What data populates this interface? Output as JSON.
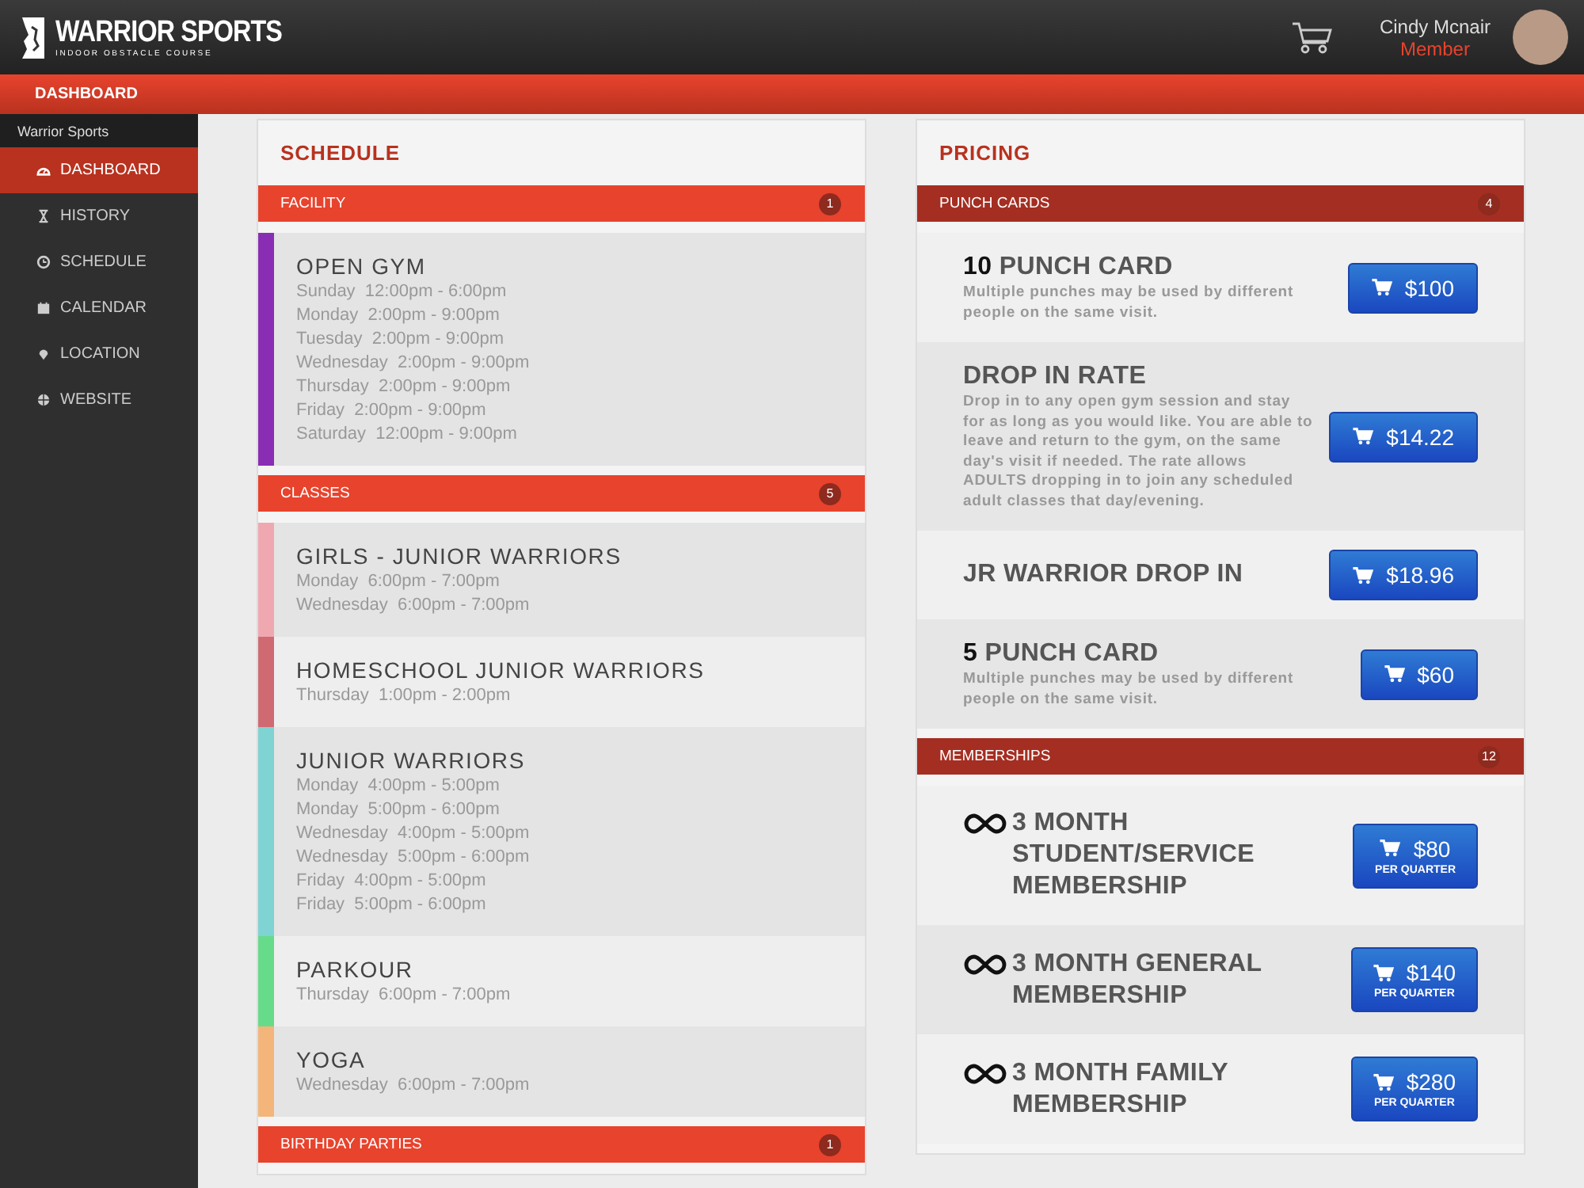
{
  "header": {
    "logo_title": "WARRIOR SPORTS",
    "logo_subtitle": "INDOOR OBSTACLE COURSE",
    "user": {
      "name": "Cindy Mcnair",
      "role": "Member"
    }
  },
  "breadcrumb": "DASHBOARD",
  "sidebar": {
    "title": "Warrior Sports",
    "items": [
      {
        "label": "DASHBOARD",
        "selected": true
      },
      {
        "label": "HISTORY",
        "selected": false
      },
      {
        "label": "SCHEDULE",
        "selected": false
      },
      {
        "label": "CALENDAR",
        "selected": false
      },
      {
        "label": "LOCATION",
        "selected": false
      },
      {
        "label": "WEBSITE",
        "selected": false
      }
    ]
  },
  "schedule": {
    "title": "SCHEDULE",
    "sections": [
      {
        "title": "FACILITY",
        "count": "1",
        "items": [
          {
            "name": "OPEN GYM",
            "color": "#8a2db5",
            "times": [
              "Sunday  12:00pm - 6:00pm",
              "Monday  2:00pm - 9:00pm",
              "Tuesday  2:00pm - 9:00pm",
              "Wednesday  2:00pm - 9:00pm",
              "Thursday  2:00pm - 9:00pm",
              "Friday  2:00pm - 9:00pm",
              "Saturday  12:00pm - 9:00pm"
            ]
          }
        ]
      },
      {
        "title": "CLASSES",
        "count": "5",
        "items": [
          {
            "name": "GIRLS - JUNIOR WARRIORS",
            "color": "#f0a8b0",
            "times": [
              "Monday  6:00pm - 7:00pm",
              "Wednesday  6:00pm - 7:00pm"
            ]
          },
          {
            "name": "HOMESCHOOL JUNIOR WARRIORS",
            "color": "#cf6a72",
            "times": [
              "Thursday  1:00pm - 2:00pm"
            ]
          },
          {
            "name": "JUNIOR WARRIORS",
            "color": "#7fd3d3",
            "times": [
              "Monday  4:00pm - 5:00pm",
              "Monday  5:00pm - 6:00pm",
              "Wednesday  4:00pm - 5:00pm",
              "Wednesday  5:00pm - 6:00pm",
              "Friday  4:00pm - 5:00pm",
              "Friday  5:00pm - 6:00pm"
            ]
          },
          {
            "name": "PARKOUR",
            "color": "#66db8a",
            "times": [
              "Thursday  6:00pm - 7:00pm"
            ]
          },
          {
            "name": "YOGA",
            "color": "#f4b57a",
            "times": [
              "Wednesday  6:00pm - 7:00pm"
            ]
          }
        ]
      },
      {
        "title": "BIRTHDAY PARTIES",
        "count": "1"
      }
    ]
  },
  "pricing": {
    "title": "PRICING",
    "sections": [
      {
        "title": "PUNCH CARDS",
        "count": "4",
        "kind": "punch",
        "items": [
          {
            "name": "**10** PUNCH CARD",
            "description": "Multiple punches may be used by different people on the same visit.",
            "price": "$100"
          },
          {
            "name": "DROP IN RATE",
            "description": "Drop in to any open gym session and stay for as long as you would like. You are able to leave and return to the gym, on the same day's visit if needed. The rate allows ADULTS dropping in to join any scheduled adult classes that day/evening.",
            "price": "$14.22"
          },
          {
            "name": "JR WARRIOR DROP IN",
            "price": "$18.96"
          },
          {
            "name": "**5** PUNCH CARD",
            "description": "Multiple punches may be used by different people on the same visit.",
            "price": "$60"
          }
        ]
      },
      {
        "title": "MEMBERSHIPS",
        "count": "12",
        "kind": "membership",
        "items": [
          {
            "name": "3 MONTH STUDENT/SERVICE MEMBERSHIP",
            "price": "$80",
            "period": "PER QUARTER"
          },
          {
            "name": "3 MONTH GENERAL MEMBERSHIP",
            "price": "$140",
            "period": "PER QUARTER"
          },
          {
            "name": "3 MONTH FAMILY MEMBERSHIP",
            "price": "$280",
            "period": "PER QUARTER"
          }
        ]
      }
    ]
  }
}
